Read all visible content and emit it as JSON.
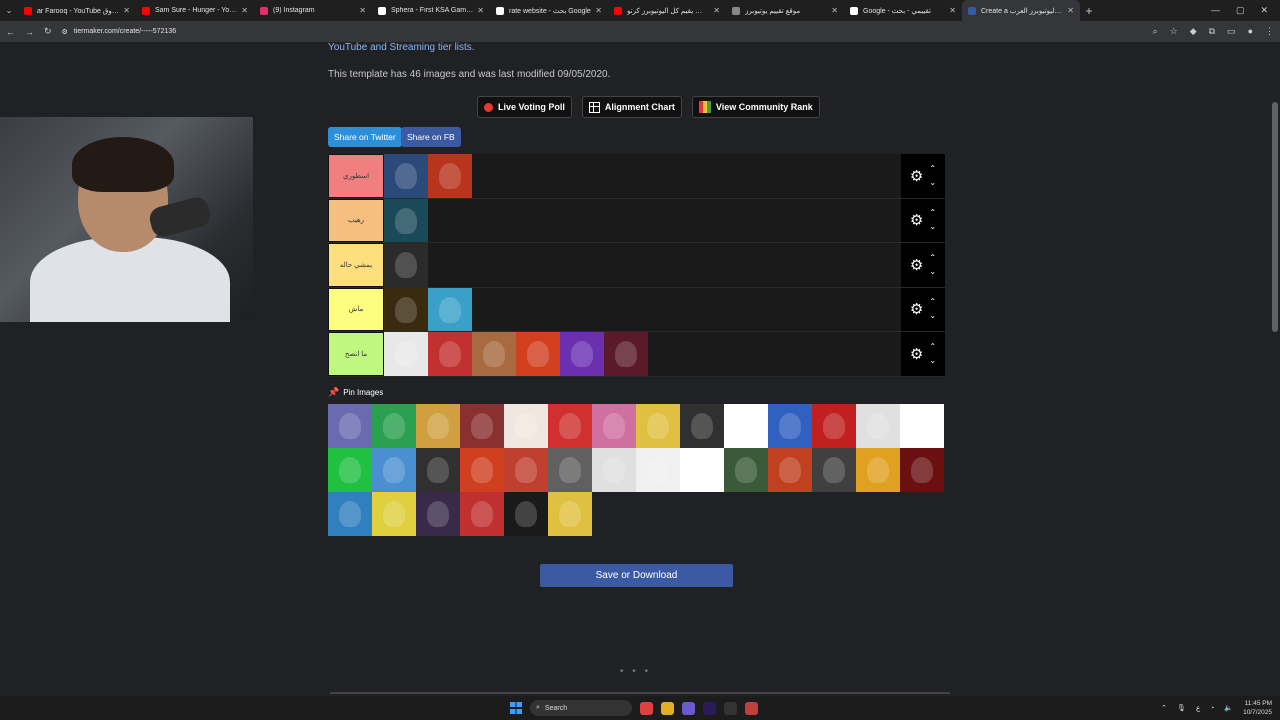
{
  "browser": {
    "tabs": [
      {
        "title": "ar Farooq - YouTube عمر فاروق",
        "color": "#ff0000"
      },
      {
        "title": "Sam Sure - Hunger - YouTu",
        "color": "#ff0000"
      },
      {
        "title": "(9) Instagram",
        "color": "#e1306c"
      },
      {
        "title": "Sphera - First KSA Game Serv",
        "color": "#ffffff"
      },
      {
        "title": "rate website - بحث Google",
        "color": "#ffffff"
      },
      {
        "title": "ليش يقيم كل اليوتيوبرز كرتو - be",
        "color": "#ff0000"
      },
      {
        "title": "موقع تقييم يوتيوبرز",
        "color": "#888888"
      },
      {
        "title": "Google - تقييمي - بحث",
        "color": "#ffffff"
      },
      {
        "title": "Create a العرب اليوتيوبرز العرب",
        "color": "#3b5aa3"
      }
    ],
    "active_tab": 8,
    "url": "tiermaker.com/create/-----572136",
    "new_tab": "+",
    "tab_close": "✕"
  },
  "page": {
    "link_text": "YouTube and Streaming tier lists.",
    "info_text": "This template has 46 images and was last modified 09/05/2020.",
    "buttons": {
      "live_voting": "Live Voting Poll",
      "alignment": "Alignment Chart",
      "community": "View Community Rank"
    },
    "share_twitter": "Share on Twitter",
    "share_fb": "Share on FB",
    "tiers": [
      {
        "label": "اسطوري",
        "color": "#f27f7f",
        "images": [
          "#2a4a7a",
          "#b8341c"
        ]
      },
      {
        "label": "رهيب",
        "color": "#f7bf7f",
        "images": [
          "#1a4a5a"
        ]
      },
      {
        "label": "يمشي حاله",
        "color": "#fddf7f",
        "images": [
          "#2b2b2b"
        ]
      },
      {
        "label": "ماش",
        "color": "#fdfd7f",
        "images": [
          "#3a2a10",
          "#3aa0c8"
        ]
      },
      {
        "label": "ما انصح",
        "color": "#bff77f",
        "images": [
          "#e8e8e8",
          "#c23030",
          "#a86a40",
          "#d24020",
          "#6a30b0",
          "#5a1a2a"
        ]
      }
    ],
    "pin_label": "Pin Images",
    "pool": [
      "#6a6ab0",
      "#2aa050",
      "#d0a040",
      "#8a3030",
      "#f0e8e0",
      "#d03030",
      "#d070a0",
      "#e0c040",
      "#303030",
      "#ffffff",
      "#3060c0",
      "#c02020",
      "#e0e0e0",
      "#ffffff",
      "#20c040",
      "#4a90d0",
      "#303030",
      "#d04020",
      "#c04030",
      "#606060",
      "#e0e0e0",
      "#f0f0f0",
      "#ffffff",
      "#3a5a3a",
      "#c04020",
      "#404040",
      "#e0a020",
      "#6a1010",
      "#3080c0",
      "#e0d040",
      "#3a2a4a",
      "#c03030",
      "#1a1a1a",
      "#e0c040"
    ],
    "save_label": "Save or Download",
    "loading_dots": "• • •"
  },
  "taskbar": {
    "search_label": "Search",
    "time": "11:45 PM",
    "date": "10/7/2025",
    "lang": "ع"
  }
}
